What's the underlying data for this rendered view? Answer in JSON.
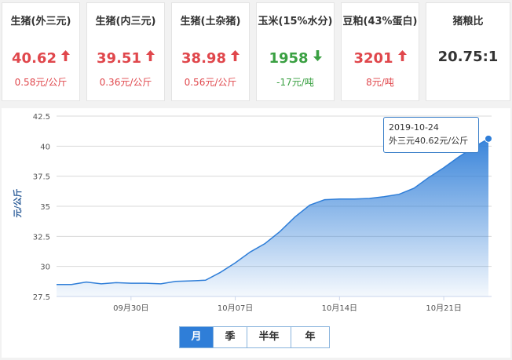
{
  "cards": [
    {
      "title": "生猪(外三元)",
      "price": "40.62",
      "direction": "up",
      "change": "0.58元/公斤"
    },
    {
      "title": "生猪(内三元)",
      "price": "39.51",
      "direction": "up",
      "change": "0.36元/公斤"
    },
    {
      "title": "生猪(土杂猪)",
      "price": "38.98",
      "direction": "up",
      "change": "0.56元/公斤"
    },
    {
      "title": "玉米(15%水分)",
      "price": "1958",
      "direction": "down",
      "change": "-17元/吨"
    },
    {
      "title": "豆粕(43%蛋白)",
      "price": "3201",
      "direction": "up",
      "change": "8元/吨"
    },
    {
      "title": "猪粮比",
      "price": "20.75:1",
      "direction": "none",
      "change": ""
    }
  ],
  "colors": {
    "up": "#e0474c",
    "down": "#3aa042",
    "accent": "#2f7ed8"
  },
  "icons": {
    "up": "arrow-up-icon",
    "down": "arrow-down-icon"
  },
  "tooltip": {
    "date": "2019-10-24",
    "text": "外三元40.62元/公斤"
  },
  "tabs": [
    {
      "label": "月",
      "active": true
    },
    {
      "label": "季",
      "active": false
    },
    {
      "label": "半年",
      "active": false
    },
    {
      "label": "年",
      "active": false
    }
  ],
  "chart_data": {
    "type": "area",
    "ylabel": "元/公斤",
    "ylim": [
      27.5,
      42.5
    ],
    "yticks": [
      "27.5",
      "30",
      "32.5",
      "35",
      "37.5",
      "40",
      "42.5"
    ],
    "xticks": [
      {
        "label": "09月30日",
        "date": "2019-09-30"
      },
      {
        "label": "10月07日",
        "date": "2019-10-07"
      },
      {
        "label": "10月14日",
        "date": "2019-10-14"
      },
      {
        "label": "10月21日",
        "date": "2019-10-21"
      }
    ],
    "grid": true,
    "series": [
      {
        "x": [
          "2019-09-25",
          "2019-09-26",
          "2019-09-27",
          "2019-09-28",
          "2019-09-29",
          "2019-09-30",
          "2019-10-01",
          "2019-10-02",
          "2019-10-03",
          "2019-10-04",
          "2019-10-05",
          "2019-10-06",
          "2019-10-07",
          "2019-10-08",
          "2019-10-09",
          "2019-10-10",
          "2019-10-11",
          "2019-10-12",
          "2019-10-13",
          "2019-10-14",
          "2019-10-15",
          "2019-10-16",
          "2019-10-17",
          "2019-10-18",
          "2019-10-19",
          "2019-10-20",
          "2019-10-21",
          "2019-10-22",
          "2019-10-23",
          "2019-10-24"
        ],
        "values": [
          28.5,
          28.5,
          28.7,
          28.55,
          28.65,
          28.6,
          28.6,
          28.55,
          28.75,
          28.8,
          28.85,
          29.5,
          30.3,
          31.2,
          31.9,
          32.9,
          34.1,
          35.1,
          35.55,
          35.6,
          35.6,
          35.65,
          35.8,
          36.0,
          36.5,
          37.4,
          38.2,
          39.1,
          39.9,
          40.62
        ]
      }
    ]
  }
}
